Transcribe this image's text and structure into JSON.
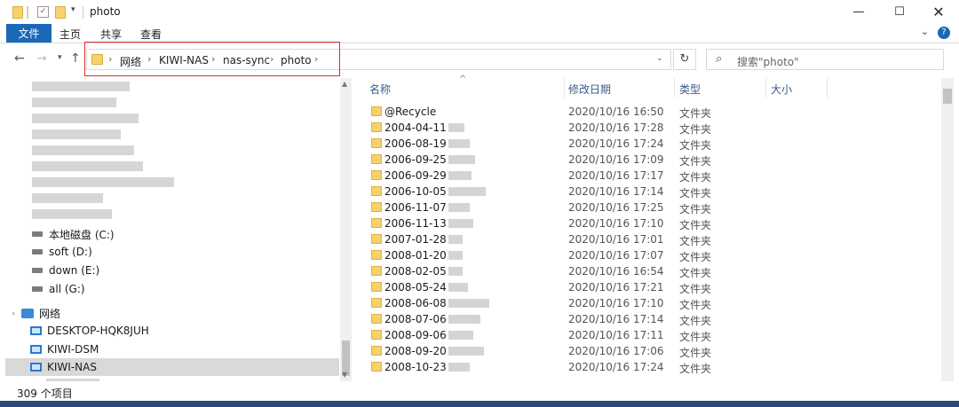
{
  "window": {
    "title": "photo"
  },
  "ribbon": {
    "file": "文件",
    "home": "主页",
    "share": "共享",
    "view": "查看"
  },
  "address": {
    "crumbs": [
      "网络",
      "KIWI-NAS",
      "nas-sync",
      "photo"
    ]
  },
  "search": {
    "placeholder": "搜索\"photo\""
  },
  "tree": {
    "drives": [
      {
        "label": "本地磁盘 (C:)"
      },
      {
        "label": "soft (D:)"
      },
      {
        "label": "down (E:)"
      },
      {
        "label": "all (G:)"
      }
    ],
    "network_label": "网络",
    "computers": [
      {
        "label": "DESKTOP-HQK8JUH"
      },
      {
        "label": "KIWI-DSM"
      },
      {
        "label": "KIWI-NAS"
      }
    ]
  },
  "columns": {
    "name": "名称",
    "modified": "修改日期",
    "type": "类型",
    "size": "大小"
  },
  "files": [
    {
      "name": "@Recycle",
      "modified": "2020/10/16 16:50",
      "type": "文件夹"
    },
    {
      "name": "2004-04-11",
      "modified": "2020/10/16 17:28",
      "type": "文件夹"
    },
    {
      "name": "2006-08-19",
      "modified": "2020/10/16 17:24",
      "type": "文件夹"
    },
    {
      "name": "2006-09-25",
      "modified": "2020/10/16 17:09",
      "type": "文件夹"
    },
    {
      "name": "2006-09-29",
      "modified": "2020/10/16 17:17",
      "type": "文件夹"
    },
    {
      "name": "2006-10-05",
      "modified": "2020/10/16 17:14",
      "type": "文件夹"
    },
    {
      "name": "2006-11-07",
      "modified": "2020/10/16 17:25",
      "type": "文件夹"
    },
    {
      "name": "2006-11-13",
      "modified": "2020/10/16 17:10",
      "type": "文件夹"
    },
    {
      "name": "2007-01-28",
      "modified": "2020/10/16 17:01",
      "type": "文件夹"
    },
    {
      "name": "2008-01-20",
      "modified": "2020/10/16 17:07",
      "type": "文件夹"
    },
    {
      "name": "2008-02-05",
      "modified": "2020/10/16 16:54",
      "type": "文件夹"
    },
    {
      "name": "2008-05-24",
      "modified": "2020/10/16 17:21",
      "type": "文件夹"
    },
    {
      "name": "2008-06-08",
      "modified": "2020/10/16 17:10",
      "type": "文件夹"
    },
    {
      "name": "2008-07-06",
      "modified": "2020/10/16 17:14",
      "type": "文件夹"
    },
    {
      "name": "2008-09-06",
      "modified": "2020/10/16 17:11",
      "type": "文件夹"
    },
    {
      "name": "2008-09-20",
      "modified": "2020/10/16 17:06",
      "type": "文件夹"
    },
    {
      "name": "2008-10-23",
      "modified": "2020/10/16 17:24",
      "type": "文件夹"
    }
  ],
  "status": {
    "count": "309 个项目"
  }
}
